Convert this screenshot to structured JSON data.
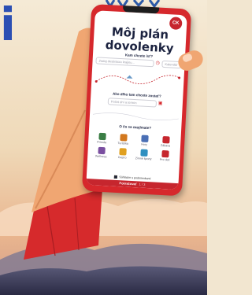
{
  "brand": {
    "letter": "i"
  },
  "app": {
    "logo": "CK",
    "title": "Môj plán dovolenky",
    "q1": {
      "label": "Kam chcete ísť?",
      "field_placeholder": "Zadaj destináciu krajinu...",
      "date_placeholder": "Kalendár"
    },
    "q2": {
      "label": "Ako dlho tam chcete zostať?",
      "field_placeholder": "Počet dní a termín"
    },
    "q3": {
      "label": "O čo sa zaujímate?"
    },
    "interests": [
      {
        "label": "Príroda",
        "color": "#3a7d44"
      },
      {
        "label": "Turistika",
        "color": "#d2781e"
      },
      {
        "label": "Hory",
        "color": "#4a6fb5"
      },
      {
        "label": "Zábava",
        "color": "#c6262e"
      },
      {
        "label": "Wellness",
        "color": "#7a4fa0"
      },
      {
        "label": "Gastro",
        "color": "#e0a020"
      },
      {
        "label": "Zimné športy",
        "color": "#2f8fc0"
      },
      {
        "label": "Pre deti",
        "color": "#c6262e"
      }
    ],
    "consent": "Súhlasím s podmienkami",
    "submit": {
      "label": "Pokračovať",
      "step": "1 / 3"
    }
  },
  "colors": {
    "phone": "#d6282c",
    "sleeve": "#d62a2c",
    "skin": "#f0a672",
    "sky": "#f2e6d0",
    "mountain": "#3d3f5c"
  }
}
